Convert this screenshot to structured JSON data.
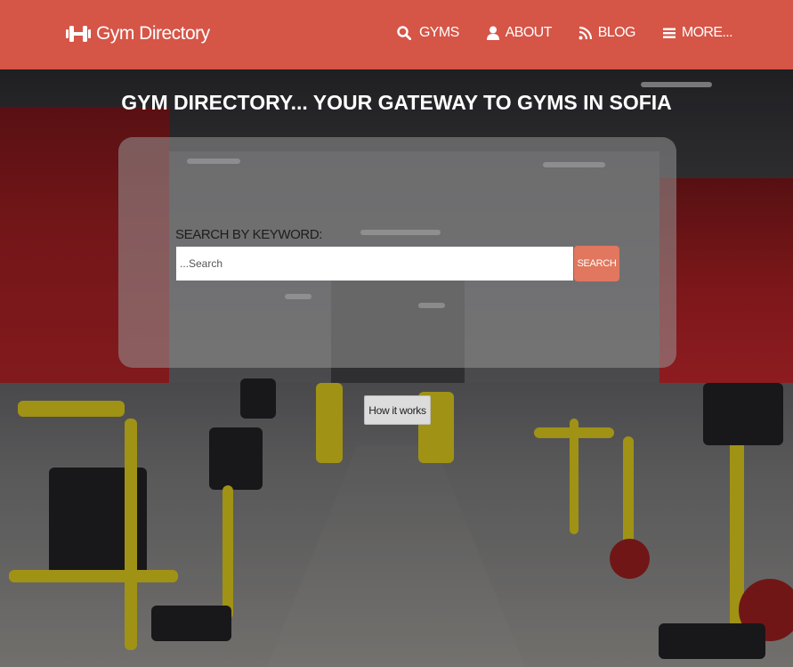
{
  "header": {
    "brand": "Gym Directory",
    "brand_icon": "dumbbell-icon",
    "background_color": "#d55547",
    "nav": [
      {
        "label": "GYMS",
        "icon": "search-icon"
      },
      {
        "label": "ABOUT",
        "icon": "user-icon"
      },
      {
        "label": "BLOG",
        "icon": "rss-icon"
      },
      {
        "label": "MORE...",
        "icon": "menu-icon"
      }
    ]
  },
  "hero": {
    "title": "GYM DIRECTORY... YOUR GATEWAY TO GYMS IN SOFIA"
  },
  "search": {
    "label": "SEARCH BY KEYWORD:",
    "placeholder": "...Search",
    "value": "",
    "button_label": "SEARCH",
    "button_color": "#e0775e"
  },
  "how_it_works": {
    "label": "How it works"
  }
}
